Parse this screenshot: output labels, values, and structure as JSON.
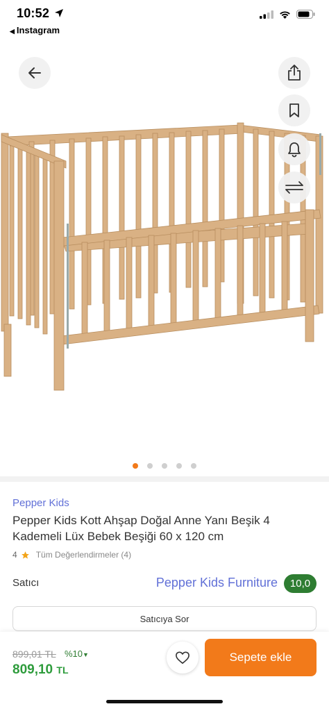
{
  "status": {
    "time": "10:52",
    "back_app": "Instagram",
    "icons": [
      "location-arrow-icon",
      "cellular-signal-icon",
      "wifi-icon",
      "battery-icon"
    ]
  },
  "media": {
    "image_subject": "wooden-baby-crib",
    "actions": [
      "back-arrow-icon",
      "share-icon",
      "bookmark-icon",
      "bell-icon",
      "compare-arrows-icon"
    ],
    "dots_total": 5,
    "dots_active_index": 0
  },
  "product": {
    "brand": "Pepper Kids",
    "title": "Pepper Kids Kott Ahşap Doğal Anne Yanı Beşik 4 Kademeli Lüx Bebek Beşiği 60 x 120 cm",
    "rating": "4",
    "reviews_link": "Tüm Değerlendirmeler (4)"
  },
  "seller": {
    "label": "Satıcı",
    "name": "Pepper Kids Furniture",
    "score": "10,0",
    "ask_button": "Satıcıya Sor"
  },
  "price": {
    "old": "899,01 TL",
    "discount": "%10",
    "new_amount": "809,10",
    "new_currency": "TL",
    "add_to_cart": "Sepete ekle"
  },
  "colors": {
    "accent": "#f27a1a",
    "brand_link": "#6170d7",
    "price_green": "#2e9c3c",
    "score_badge": "#2e7d32",
    "wood": "#d9b184"
  }
}
